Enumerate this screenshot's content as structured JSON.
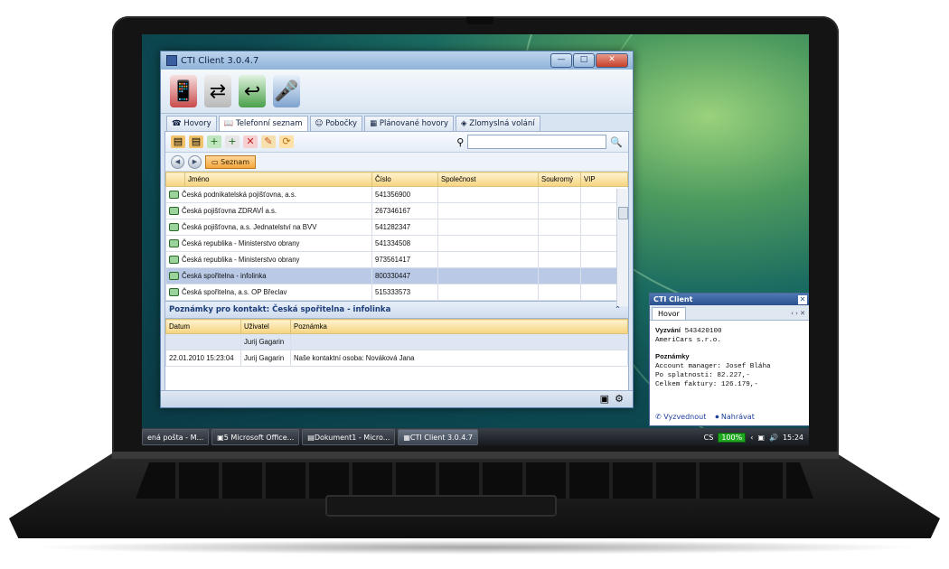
{
  "window": {
    "title": "CTI Client 3.0.4.7",
    "controls": {
      "minimize": "—",
      "maximize": "□",
      "close": "✕"
    }
  },
  "toolbar_icons": [
    "phone-icon",
    "transfer-icon",
    "phone-hangup-icon",
    "microphone-icon"
  ],
  "tabs": [
    {
      "label": "Hovory",
      "icon": "phone-icon"
    },
    {
      "label": "Telefonní seznam",
      "icon": "book-icon",
      "active": true
    },
    {
      "label": "Pobočky",
      "icon": "people-icon"
    },
    {
      "label": "Plánované hovory",
      "icon": "calendar-icon"
    },
    {
      "label": "Zlomyslná volání",
      "icon": "shield-icon"
    }
  ],
  "search": {
    "placeholder": "",
    "icon": "magnifier-icon"
  },
  "breadcrumb": "Seznam",
  "contacts": {
    "columns": [
      "Jméno",
      "Číslo",
      "Společnost",
      "Soukromý",
      "VIP"
    ],
    "rows": [
      {
        "name": "Česká podnikatelská pojišťovna, a.s.",
        "number": "541356900"
      },
      {
        "name": "Česká pojišťovna ZDRAVÍ a.s.",
        "number": "267346167"
      },
      {
        "name": "Česká pojišťovna, a.s. Jednatelství na BVV",
        "number": "541282347"
      },
      {
        "name": "Česká republika - Ministerstvo obrany",
        "number": "541334508"
      },
      {
        "name": "Česká republika - Ministerstvo obrany",
        "number": "973561417"
      },
      {
        "name": "Česká spořitelna - infolinka",
        "number": "800330447",
        "selected": true
      },
      {
        "name": "Česká spořitelna, a.s.  OP Břeclav",
        "number": "515333573"
      }
    ]
  },
  "notes": {
    "title": "Poznámky pro kontakt: Česká spořitelna - infolinka",
    "columns": [
      "Datum",
      "Uživatel",
      "Poznámka"
    ],
    "rows": [
      {
        "date": "",
        "user": "Jurij Gagarin",
        "note": ""
      },
      {
        "date": "22.01.2010 15:23:04",
        "user": "Jurij Gagarin",
        "note": "Naše kontaktní osoba: Nováková Jana"
      }
    ]
  },
  "popup": {
    "title": "CTI Client",
    "tab": "Hovor",
    "calling_label": "Vyzvání",
    "calling_number": "543420100",
    "company": "AmeriCars s.r.o.",
    "notes_label": "Poznámky",
    "lines": [
      "Account manager: Josef Bláha",
      "Po splatnosti: 82.227,-",
      "Celkem faktury: 126.179,-"
    ],
    "answer": "Vyzvednout",
    "record": "Nahrávat"
  },
  "taskbar": {
    "items": [
      "ená pošta - M...",
      "5 Microsoft Office...",
      "Dokument1 - Micro...",
      "CTI Client 3.0.4.7"
    ],
    "lang": "CS",
    "battery": "100%",
    "clock": "15:24"
  }
}
